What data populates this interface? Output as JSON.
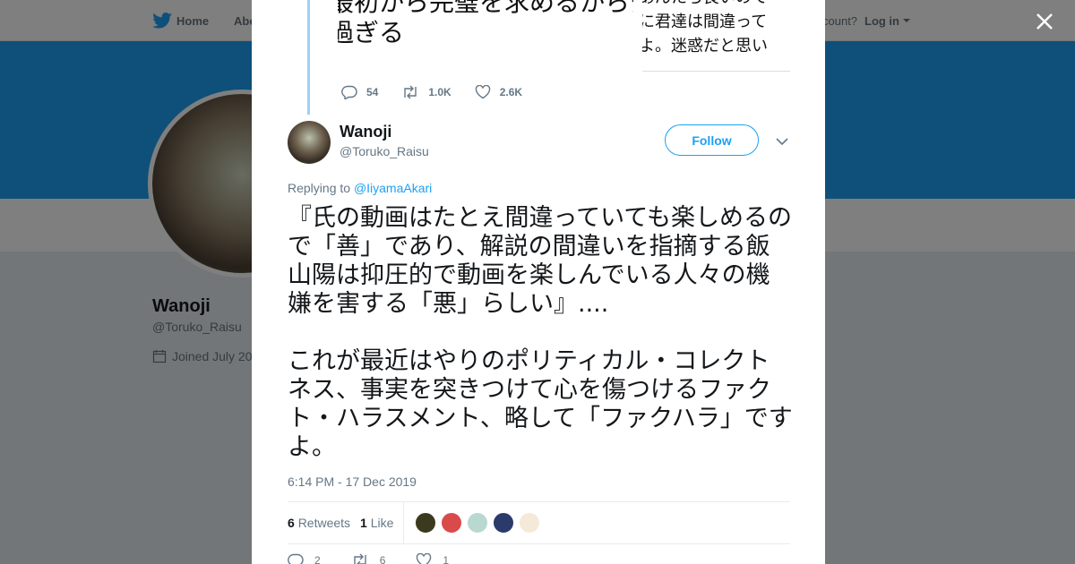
{
  "nav": {
    "home_label": "Home",
    "about_label": "Abo",
    "account_text": "count?",
    "login_label": "Log in"
  },
  "background_profile": {
    "name": "Wanoji",
    "handle": "@Toruko_Raisu",
    "joined": "Joined July 20"
  },
  "quoted_image": {
    "left_lines": [
      "最初から完璧を求めるから夕",
      "過ぎる"
    ],
    "right_lines": [
      "あんたら良いので",
      "に君達は間違って",
      "よ。迷惑だと思い"
    ]
  },
  "previous_tweet": {
    "replies": "54",
    "retweets": "1.0K",
    "likes": "2.6K"
  },
  "tweet": {
    "author_name": "Wanoji",
    "author_handle": "@Toruko_Raisu",
    "follow_label": "Follow",
    "replying_prefix": "Replying to",
    "replying_to": "@IiyamaAkari",
    "paragraph1": "『氏の動画はたとえ間違っていても楽しめるので「善」であり、解説の間違いを指摘する飯山陽は抑圧的で動画を楽しんでいる人々の機嫌を害する「悪」らしい』....",
    "paragraph2": "これが最近はやりのポリティカル・コレクトネス、事実を突きつけて心を傷つけるファクト・ハラスメント、略して「ファクハラ」ですよ。",
    "timestamp": "6:14 PM - 17 Dec 2019",
    "retweet_count": "6",
    "retweet_label": "Retweets",
    "like_count": "1",
    "like_label": "Like",
    "liker_colors": [
      "#3b3a1e",
      "#d94b4b",
      "#b8d8d0",
      "#2a3a6b",
      "#f5e9d8"
    ],
    "reply_count": "2",
    "retweet_action_count": "6",
    "like_action_count": "1"
  },
  "colors": {
    "accent": "#1da1f2",
    "text": "#14171a",
    "muted": "#657786"
  },
  "icons": [
    "twitter-bird-icon",
    "calendar-icon",
    "close-icon",
    "reply-icon",
    "retweet-icon",
    "heart-icon",
    "chevron-down-icon"
  ]
}
